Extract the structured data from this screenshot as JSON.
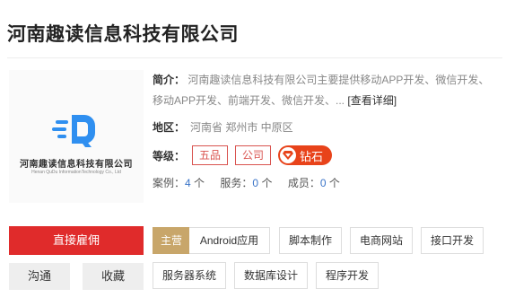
{
  "company": {
    "name": "河南趣读信息科技有限公司",
    "logo": {
      "cn_text": "河南趣读信息科技有限公司",
      "en_text": "Henan QuDu InformationTechnology Co., Ltd"
    }
  },
  "profile": {
    "intro_label": "简介：",
    "intro_text": "河南趣读信息科技有限公司主要提供移动APP开发、微信开发、移动APP开发、前端开发、微信开发、...",
    "intro_more": "[查看详细]",
    "region_label": "地区：",
    "region_text": "河南省 郑州市 中原区",
    "level_label": "等级：",
    "level_badges": [
      "五品",
      "公司"
    ],
    "diamond_label": "钻石",
    "stats": {
      "cases_label": "案例：",
      "cases_value": "4",
      "services_label": "服务：",
      "services_value": "0",
      "members_label": "成员：",
      "members_value": "0",
      "unit": "个"
    }
  },
  "actions": {
    "hire": "直接雇佣",
    "chat": "沟通",
    "favorite": "收藏"
  },
  "tags": {
    "main_label": "主营",
    "items": [
      "Android应用",
      "脚本制作",
      "电商网站",
      "接口开发",
      "服务器系统",
      "数据库设计",
      "程序开发"
    ]
  },
  "colors": {
    "accent_red": "#e02b2b",
    "badge_red": "#d9534f",
    "diamond": "#e8431a",
    "main_tag": "#c8a66a",
    "stat_blue": "#3a74c8",
    "logo_blue": "#2f8ff0"
  }
}
